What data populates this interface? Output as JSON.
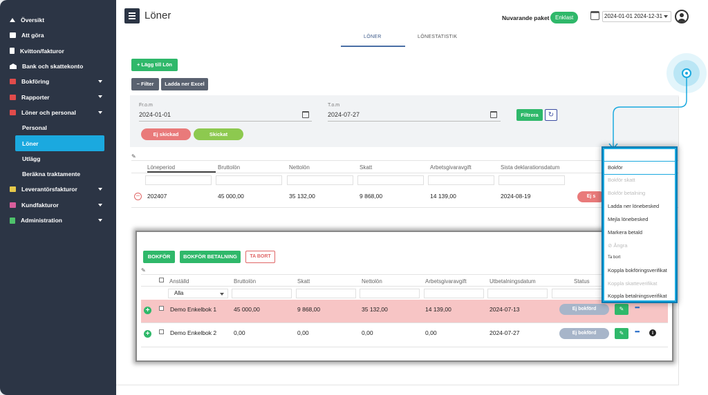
{
  "sidebar": {
    "items": [
      {
        "label": "Översikt",
        "icon": "home-icon"
      },
      {
        "label": "Att göra",
        "icon": "inbox-icon"
      },
      {
        "label": "Kvitton/fakturor",
        "icon": "receipt-icon"
      },
      {
        "label": "Bank och skattekonto",
        "icon": "bank-icon"
      },
      {
        "label": "Bokföring",
        "icon": "ledger-icon"
      },
      {
        "label": "Rapporter",
        "icon": "report-icon"
      },
      {
        "label": "Löner och personal",
        "icon": "payroll-icon"
      },
      {
        "label": "Personal"
      },
      {
        "label": "Löner"
      },
      {
        "label": "Utlägg"
      },
      {
        "label": "Beräkna traktamente"
      },
      {
        "label": "Leverantörsfakturor",
        "icon": "supplier-invoice-icon"
      },
      {
        "label": "Kundfakturor",
        "icon": "customer-invoice-icon"
      },
      {
        "label": "Administration",
        "icon": "admin-icon"
      }
    ]
  },
  "header": {
    "title": "Löner",
    "paket_label": "Nuvarande paket",
    "paket_value": "Enklast",
    "date_range": "2024-01-01 2024-12-31"
  },
  "tabs": [
    "LÖNER",
    "LÖNESTATISTIK"
  ],
  "toolbar": {
    "add_label": "+ Lägg till Lön",
    "filter_label": "− Filter",
    "excel_label": "Ladda ner Excel"
  },
  "filter": {
    "from_label": "Fr.o.m",
    "from_value": "2024-01-01",
    "to_label": "T.o.m",
    "to_value": "2024-07-27",
    "filter_button": "Filtrera",
    "refresh_glyph": "↻",
    "pill_unsent": "Ej skickad",
    "pill_sent": "Skickat"
  },
  "salary_table": {
    "headers": [
      "Löneperiod",
      "Bruttolön",
      "Nettolön",
      "Skatt",
      "Arbetsgivaravgift",
      "Sista deklarationsdatum"
    ],
    "row": {
      "period": "202407",
      "brutto": "45 000,00",
      "netto": "35 132,00",
      "skatt": "9 868,00",
      "avgift": "14 139,00",
      "datum": "2024-08-19",
      "status": "Ej s"
    }
  },
  "detail": {
    "buttons": {
      "bokfor": "BOKFÖR",
      "bokfor_betalning": "BOKFÖR BETALNING",
      "ta_bort": "TA BORT"
    },
    "headers": [
      "Anställd",
      "Bruttolön",
      "Skatt",
      "Nettolön",
      "Arbetsgivaravgift",
      "Utbetalningsdatum",
      "Status"
    ],
    "employee_filter": "Alla",
    "rows": [
      {
        "name": "Demo Enkelbok 1",
        "brutto": "45 000,00",
        "skatt": "9 868,00",
        "netto": "35 132,00",
        "avgift": "14 139,00",
        "datum": "2024-07-13",
        "status": "Ej bokförd"
      },
      {
        "name": "Demo Enkelbok 2",
        "brutto": "0,00",
        "skatt": "0,00",
        "netto": "0,00",
        "avgift": "0,00",
        "datum": "2024-07-27",
        "status": "Ej bokförd"
      }
    ]
  },
  "menu": {
    "items": [
      {
        "label": "Bokför",
        "muted": false
      },
      {
        "label": "Bokför skatt",
        "muted": true
      },
      {
        "label": "Bokför betalning",
        "muted": true
      },
      {
        "label": "Ladda ner lönebesked",
        "muted": false
      },
      {
        "label": "Mejla lönebesked",
        "muted": false
      },
      {
        "label": "Markera betald",
        "muted": false
      },
      {
        "label": "Ångra",
        "muted": true
      },
      {
        "label": "Ta bort",
        "muted": false
      },
      {
        "label": "Koppla bokföringsverifikat",
        "muted": false
      },
      {
        "label": "Koppla skatteverifikat",
        "muted": true
      },
      {
        "label": "Koppla betalningsverifikat",
        "muted": false
      }
    ]
  },
  "colors": {
    "sidebar_bg": "#2c3545",
    "accent": "#1ba9df",
    "primary_green": "#2fb86a",
    "danger": "#e06666",
    "row_highlight": "#f7c5c5"
  }
}
